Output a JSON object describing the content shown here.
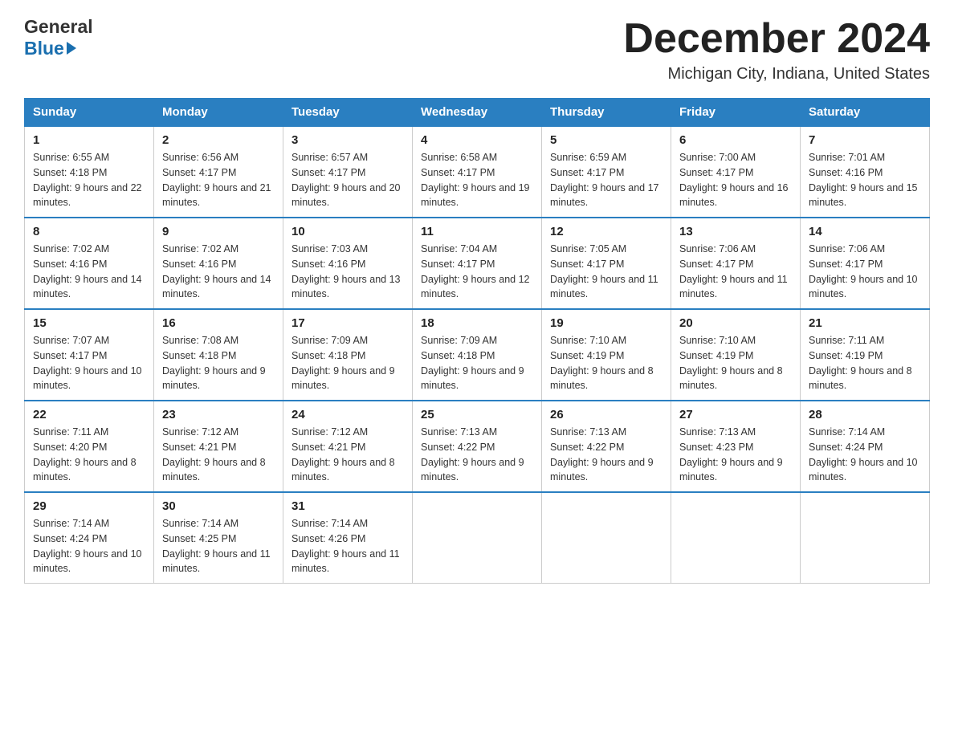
{
  "header": {
    "logo_general": "General",
    "logo_blue": "Blue",
    "month_title": "December 2024",
    "location": "Michigan City, Indiana, United States"
  },
  "days_of_week": [
    "Sunday",
    "Monday",
    "Tuesday",
    "Wednesday",
    "Thursday",
    "Friday",
    "Saturday"
  ],
  "weeks": [
    [
      {
        "day": "1",
        "sunrise": "6:55 AM",
        "sunset": "4:18 PM",
        "daylight": "9 hours and 22 minutes."
      },
      {
        "day": "2",
        "sunrise": "6:56 AM",
        "sunset": "4:17 PM",
        "daylight": "9 hours and 21 minutes."
      },
      {
        "day": "3",
        "sunrise": "6:57 AM",
        "sunset": "4:17 PM",
        "daylight": "9 hours and 20 minutes."
      },
      {
        "day": "4",
        "sunrise": "6:58 AM",
        "sunset": "4:17 PM",
        "daylight": "9 hours and 19 minutes."
      },
      {
        "day": "5",
        "sunrise": "6:59 AM",
        "sunset": "4:17 PM",
        "daylight": "9 hours and 17 minutes."
      },
      {
        "day": "6",
        "sunrise": "7:00 AM",
        "sunset": "4:17 PM",
        "daylight": "9 hours and 16 minutes."
      },
      {
        "day": "7",
        "sunrise": "7:01 AM",
        "sunset": "4:16 PM",
        "daylight": "9 hours and 15 minutes."
      }
    ],
    [
      {
        "day": "8",
        "sunrise": "7:02 AM",
        "sunset": "4:16 PM",
        "daylight": "9 hours and 14 minutes."
      },
      {
        "day": "9",
        "sunrise": "7:02 AM",
        "sunset": "4:16 PM",
        "daylight": "9 hours and 14 minutes."
      },
      {
        "day": "10",
        "sunrise": "7:03 AM",
        "sunset": "4:16 PM",
        "daylight": "9 hours and 13 minutes."
      },
      {
        "day": "11",
        "sunrise": "7:04 AM",
        "sunset": "4:17 PM",
        "daylight": "9 hours and 12 minutes."
      },
      {
        "day": "12",
        "sunrise": "7:05 AM",
        "sunset": "4:17 PM",
        "daylight": "9 hours and 11 minutes."
      },
      {
        "day": "13",
        "sunrise": "7:06 AM",
        "sunset": "4:17 PM",
        "daylight": "9 hours and 11 minutes."
      },
      {
        "day": "14",
        "sunrise": "7:06 AM",
        "sunset": "4:17 PM",
        "daylight": "9 hours and 10 minutes."
      }
    ],
    [
      {
        "day": "15",
        "sunrise": "7:07 AM",
        "sunset": "4:17 PM",
        "daylight": "9 hours and 10 minutes."
      },
      {
        "day": "16",
        "sunrise": "7:08 AM",
        "sunset": "4:18 PM",
        "daylight": "9 hours and 9 minutes."
      },
      {
        "day": "17",
        "sunrise": "7:09 AM",
        "sunset": "4:18 PM",
        "daylight": "9 hours and 9 minutes."
      },
      {
        "day": "18",
        "sunrise": "7:09 AM",
        "sunset": "4:18 PM",
        "daylight": "9 hours and 9 minutes."
      },
      {
        "day": "19",
        "sunrise": "7:10 AM",
        "sunset": "4:19 PM",
        "daylight": "9 hours and 8 minutes."
      },
      {
        "day": "20",
        "sunrise": "7:10 AM",
        "sunset": "4:19 PM",
        "daylight": "9 hours and 8 minutes."
      },
      {
        "day": "21",
        "sunrise": "7:11 AM",
        "sunset": "4:19 PM",
        "daylight": "9 hours and 8 minutes."
      }
    ],
    [
      {
        "day": "22",
        "sunrise": "7:11 AM",
        "sunset": "4:20 PM",
        "daylight": "9 hours and 8 minutes."
      },
      {
        "day": "23",
        "sunrise": "7:12 AM",
        "sunset": "4:21 PM",
        "daylight": "9 hours and 8 minutes."
      },
      {
        "day": "24",
        "sunrise": "7:12 AM",
        "sunset": "4:21 PM",
        "daylight": "9 hours and 8 minutes."
      },
      {
        "day": "25",
        "sunrise": "7:13 AM",
        "sunset": "4:22 PM",
        "daylight": "9 hours and 9 minutes."
      },
      {
        "day": "26",
        "sunrise": "7:13 AM",
        "sunset": "4:22 PM",
        "daylight": "9 hours and 9 minutes."
      },
      {
        "day": "27",
        "sunrise": "7:13 AM",
        "sunset": "4:23 PM",
        "daylight": "9 hours and 9 minutes."
      },
      {
        "day": "28",
        "sunrise": "7:14 AM",
        "sunset": "4:24 PM",
        "daylight": "9 hours and 10 minutes."
      }
    ],
    [
      {
        "day": "29",
        "sunrise": "7:14 AM",
        "sunset": "4:24 PM",
        "daylight": "9 hours and 10 minutes."
      },
      {
        "day": "30",
        "sunrise": "7:14 AM",
        "sunset": "4:25 PM",
        "daylight": "9 hours and 11 minutes."
      },
      {
        "day": "31",
        "sunrise": "7:14 AM",
        "sunset": "4:26 PM",
        "daylight": "9 hours and 11 minutes."
      },
      null,
      null,
      null,
      null
    ]
  ]
}
